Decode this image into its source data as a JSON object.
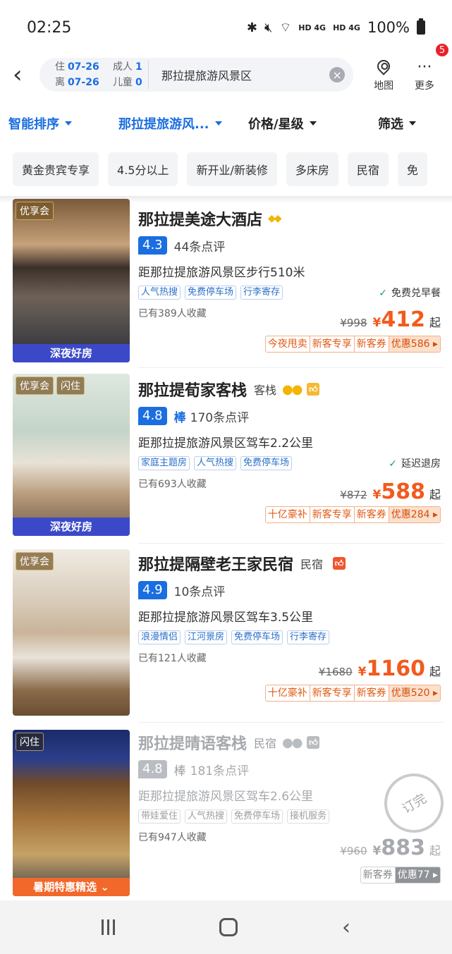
{
  "status": {
    "time": "02:25",
    "battery": "100%",
    "net1": "HD 4G",
    "net2": "HD 4G"
  },
  "search": {
    "checkin_label": "住",
    "checkin": "07-26",
    "checkout_label": "离",
    "checkout": "07-26",
    "adults_label": "成人",
    "adults": "1",
    "children_label": "儿童",
    "children": "0",
    "keyword": "那拉提旅游风景区"
  },
  "header": {
    "map_label": "地图",
    "more_label": "更多",
    "more_badge": "5"
  },
  "sort": [
    "智能排序",
    "那拉提旅游风...",
    "价格/星级",
    "筛选"
  ],
  "chips": [
    "黄金贵宾专享",
    "4.5分以上",
    "新开业/新装修",
    "多床房",
    "民宿",
    "免"
  ],
  "hotels": [
    {
      "photo_tags": [
        "优享会"
      ],
      "photo_bottom": "深夜好房",
      "name": "那拉提美途大酒店",
      "type": "",
      "score": "4.3",
      "grade": "",
      "reviews": "44条点评",
      "distance": "距那拉提旅游风景区步行510米",
      "tags": [
        "人气热搜",
        "免费停车场",
        "行李寄存"
      ],
      "perk": "免费兑早餐",
      "favs": "已有389人收藏",
      "orig_price": "¥998",
      "yen": "¥",
      "price": "412",
      "qi": "起",
      "promos": [
        "今夜甩卖",
        "新客专享",
        "新客券",
        "优惠586 ▸"
      ]
    },
    {
      "photo_tags": [
        "优享会",
        "闪住"
      ],
      "photo_bottom": "深夜好房",
      "name": "那拉提荀家客栈",
      "type": "客栈",
      "score": "4.8",
      "grade": "棒",
      "reviews": "170条点评",
      "distance": "距那拉提旅游风景区驾车2.2公里",
      "tags": [
        "家庭主题房",
        "人气热搜",
        "免费停车场"
      ],
      "perk": "延迟退房",
      "favs": "已有693人收藏",
      "orig_price": "¥872",
      "yen": "¥",
      "price": "588",
      "qi": "起",
      "promos": [
        "十亿豪补",
        "新客专享",
        "新客券",
        "优惠284 ▸"
      ]
    },
    {
      "photo_tags": [
        "优享会"
      ],
      "photo_bottom": "",
      "name": "那拉提隔壁老王家民宿",
      "type": "民宿",
      "score": "4.9",
      "grade": "",
      "reviews": "10条点评",
      "distance": "距那拉提旅游风景区驾车3.5公里",
      "tags": [
        "浪漫情侣",
        "江河景房",
        "免费停车场",
        "行李寄存"
      ],
      "perk": "",
      "favs": "已有121人收藏",
      "orig_price": "¥1680",
      "yen": "¥",
      "price": "1160",
      "qi": "起",
      "promos": [
        "十亿豪补",
        "新客专享",
        "新客券",
        "优惠520 ▸"
      ]
    },
    {
      "photo_tags": [
        "闪住"
      ],
      "photo_bottom": "暑期特惠精选",
      "name": "那拉提晴语客栈",
      "type": "民宿",
      "score": "4.8",
      "grade": "棒",
      "reviews": "181条点评",
      "distance": "距那拉提旅游风景区驾车2.6公里",
      "tags": [
        "带娃爱住",
        "人气热搜",
        "免费停车场",
        "接机服务"
      ],
      "perk": "",
      "favs": "已有947人收藏",
      "orig_price": "¥960",
      "yen": "¥",
      "price": "883",
      "qi": "起",
      "promos": [
        "新客券",
        "优惠77 ▸"
      ],
      "stamp": "订完"
    }
  ]
}
